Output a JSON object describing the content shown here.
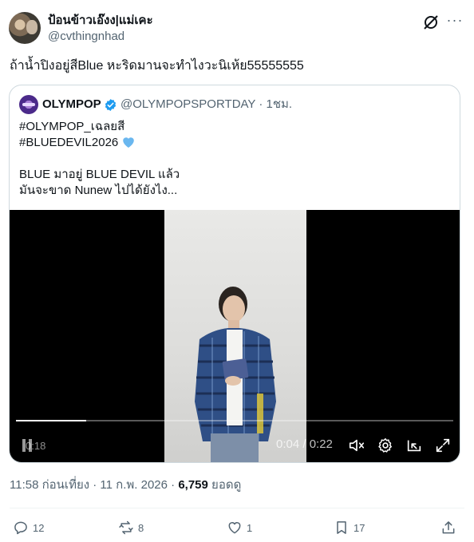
{
  "author": {
    "display_name": "ป้อนข้าวเอ๊งง|แม่เคะ",
    "handle": "@cvthingnhad"
  },
  "tweet": {
    "text": "ถ้าน้ำปิงอยู่สีBlue หะริดมานจะทำไงวะนิเห้ย55555555"
  },
  "quote": {
    "display_name": "OLYMPOP",
    "handle_time": "@OLYMPOPSPORTDAY · 1ชม.",
    "lines": [
      "#OLYMPOP_เฉลยสี",
      "#BLUEDEVIL2026",
      "BLUE มาอยู่ BLUE DEVIL แล้ว",
      "มันจะขาด Nunew ไปได้ยังไง..."
    ],
    "video": {
      "elapsed_label": "0:18",
      "timer": "0:04 / 0:22",
      "progress": 0.16
    }
  },
  "meta": {
    "timestamp": "11:58 ก่อนเที่ยง · 11 ก.พ. 2026 · ",
    "views": "6,759",
    "views_label": " ยอดดู"
  },
  "actions": {
    "replies": "12",
    "reposts": "8",
    "likes": "1",
    "bookmarks": "17"
  },
  "colors": {
    "verified": "#1d9bf0",
    "text": "#0f1419",
    "muted": "#536471"
  }
}
